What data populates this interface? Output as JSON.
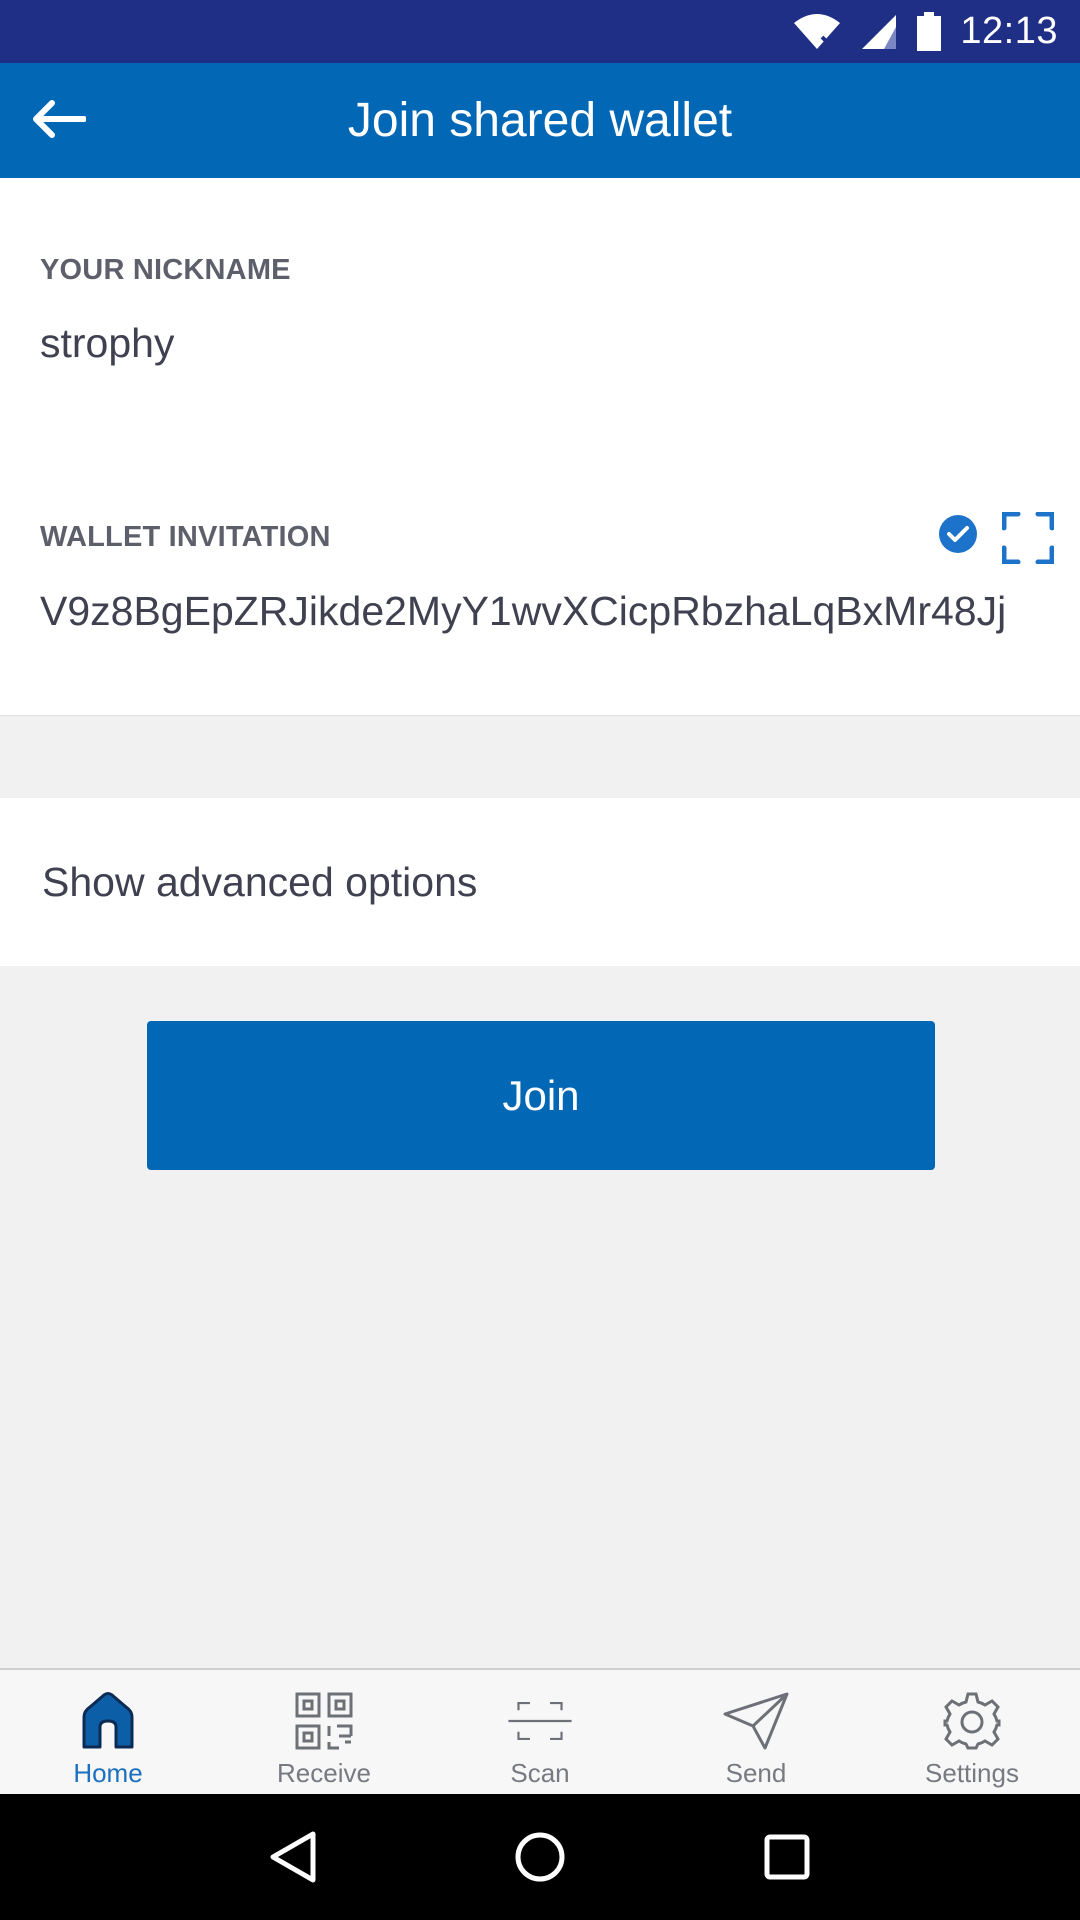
{
  "status_bar": {
    "time": "12:13",
    "icons": [
      "wifi-icon",
      "signal-icon",
      "battery-icon"
    ]
  },
  "app_bar": {
    "title": "Join shared wallet",
    "back_icon": "arrow-left-icon"
  },
  "form": {
    "nickname": {
      "label": "YOUR NICKNAME",
      "value": "strophy"
    },
    "invitation": {
      "label": "WALLET INVITATION",
      "value": "V9z8BgEpZRJikde2MyY1wvXCicpRbzhaLqBxMr48Jj",
      "valid_icon": "check-circle-icon",
      "scan_icon": "scan-frame-icon"
    }
  },
  "advanced": {
    "label": "Show advanced options"
  },
  "actions": {
    "join_label": "Join"
  },
  "bottom_nav": {
    "items": [
      {
        "label": "Home",
        "icon": "home-icon",
        "active": true
      },
      {
        "label": "Receive",
        "icon": "qr-code-icon",
        "active": false
      },
      {
        "label": "Scan",
        "icon": "scan-icon",
        "active": false
      },
      {
        "label": "Send",
        "icon": "paper-plane-icon",
        "active": false
      },
      {
        "label": "Settings",
        "icon": "gear-icon",
        "active": false
      }
    ]
  },
  "colors": {
    "status_bar": "#1f2f86",
    "primary": "#0267b4",
    "active_nav": "#1d6fc0",
    "background": "#f1f1f1"
  }
}
